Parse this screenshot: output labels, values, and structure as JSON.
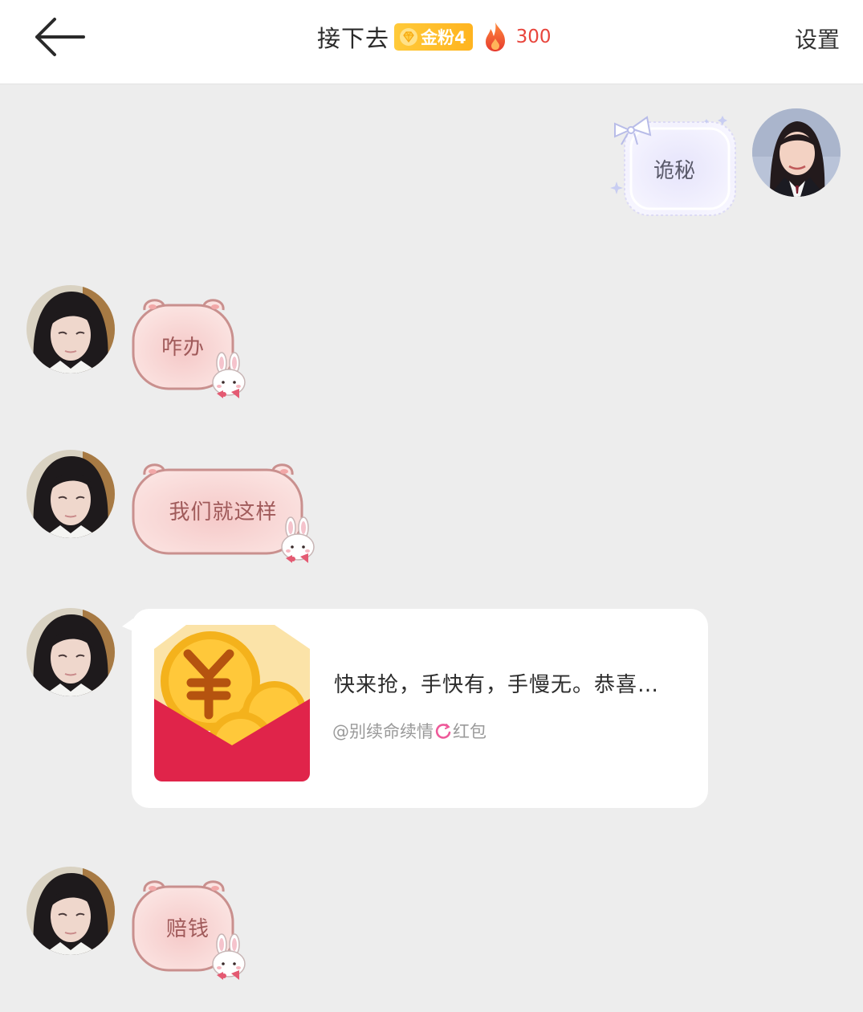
{
  "header": {
    "title": "接下去",
    "fan_badge": "金粉4",
    "fire_count": "300",
    "settings_label": "设置"
  },
  "messages": [
    {
      "side": "right",
      "type": "text",
      "text": "诡秘"
    },
    {
      "side": "left",
      "type": "text",
      "text": "咋办"
    },
    {
      "side": "left",
      "type": "text",
      "text": "我们就这样"
    },
    {
      "side": "left",
      "type": "red_packet",
      "title": "快来抢，手快有，手慢无。恭喜…",
      "sender_prefix": "@别续命续情",
      "suffix": "红包"
    },
    {
      "side": "left",
      "type": "text",
      "text": "赔钱"
    }
  ],
  "colors": {
    "background": "#ededed",
    "header": "#ffffff",
    "fan_badge": "#ffc02a",
    "fire": "#e8453c",
    "pig_bubble": "#f7d6d4",
    "pig_border": "#c9908e",
    "my_bubble": "#ecebfb",
    "red_packet": "#e0244a"
  },
  "icons": {
    "back": "arrow-left-icon",
    "badge": "diamond-icon",
    "fire": "fire-icon",
    "bunny": "bunny-sticker-icon"
  }
}
